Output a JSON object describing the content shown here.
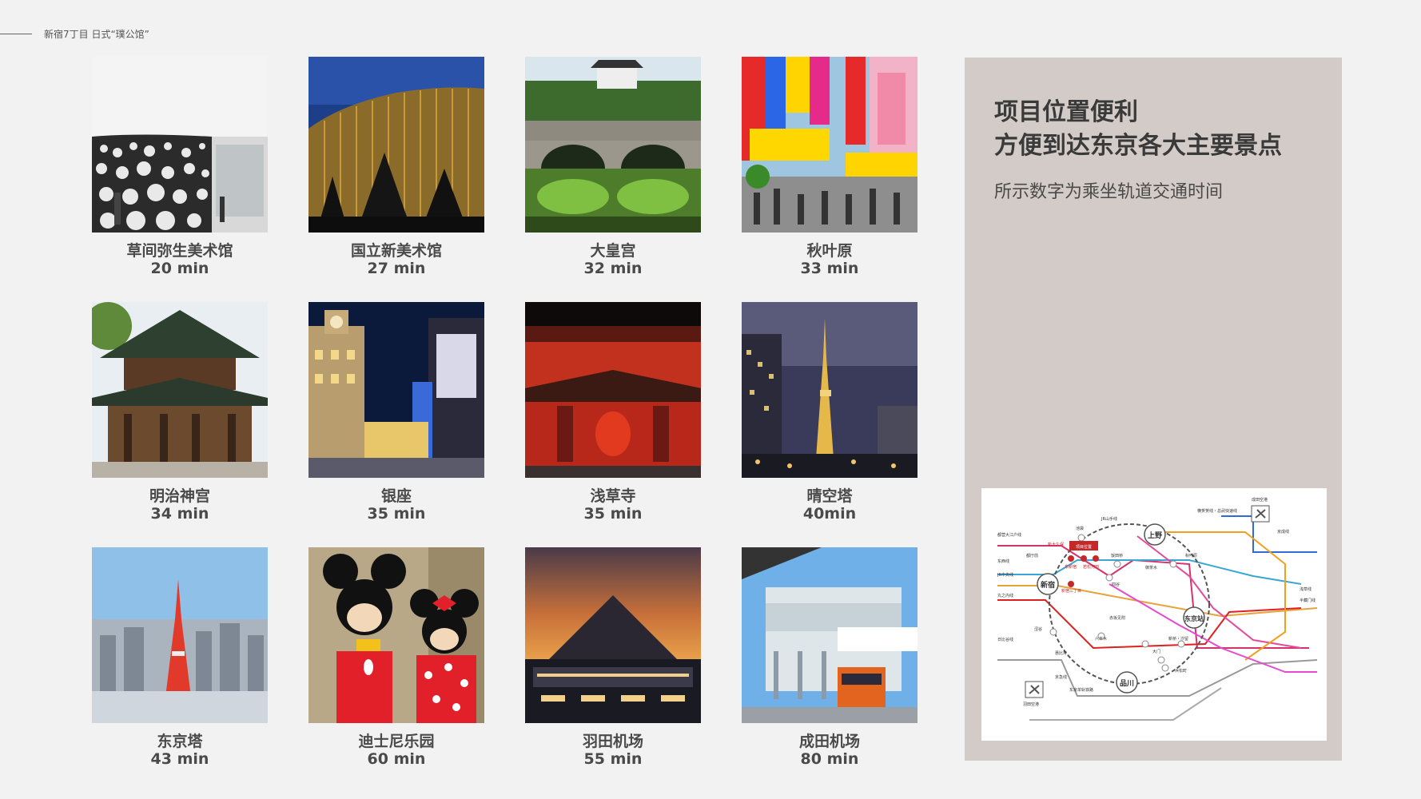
{
  "header": {
    "title": "新宿7丁目 日式“璞公馆”"
  },
  "panel": {
    "title_line1": "项目位置便利",
    "title_line2": "方便到达东京各大主要景点",
    "subtitle": "所示数字为乘坐轨道交通时间"
  },
  "spots": [
    {
      "name": "草间弥生美术馆",
      "time": "20 min"
    },
    {
      "name": "国立新美术馆",
      "time": "27 min"
    },
    {
      "name": "大皇宫",
      "time": "32 min"
    },
    {
      "name": "秋叶原",
      "time": "33 min"
    },
    {
      "name": "明治神宫",
      "time": "34 min"
    },
    {
      "name": "银座",
      "time": "35 min"
    },
    {
      "name": "浅草寺",
      "time": "35 min"
    },
    {
      "name": "晴空塔",
      "time": "40min"
    },
    {
      "name": "东京塔",
      "time": "43 min"
    },
    {
      "name": "迪士尼乐园",
      "time": "60 min"
    },
    {
      "name": "羽田机场",
      "time": "55 min"
    },
    {
      "name": "成田机场",
      "time": "80 min"
    }
  ],
  "map": {
    "stations": {
      "ueno": "上野",
      "shinjuku": "新宿",
      "tokyo": "东京站",
      "shinagawa": "品川",
      "project": "项目位置",
      "narita": "成田空港",
      "haneda": "羽田空港",
      "akihabara": "秋叶原",
      "ikebukuro": "池袋",
      "shibuya": "涩谷",
      "iidabashi": "饭田桥",
      "ochanomizu": "御茶水",
      "yotsuya": "四谷",
      "akasaka": "赤坂见附",
      "roppongi": "六本木",
      "daimon": "大门",
      "shimbashi": "新桥・汐留",
      "hamamatsucho": "浜松町",
      "ebisu": "惠比寿",
      "tochomae": "都厅前",
      "shinokubo": "新大久保",
      "higashishinjuku": "东新宿",
      "wakamatsu": "若松河田",
      "shinjuku3": "新宿三丁目",
      "asakusabashi": "浅草线",
      "ryogoku": "半藏门线"
    },
    "lines": {
      "oedo": "都营大江户线",
      "tozai": "东西线",
      "chuo": "JR中央线",
      "marunouchi": "丸之内线",
      "hibiya": "日比谷线",
      "yamanote": "JR山手线",
      "keisei": "京成线",
      "keisei_skyliner": "横贺贺线・总武快速线",
      "keikyu": "京急线",
      "monorail": "东京单轨铁路"
    },
    "colors": {
      "yamanote": "#555555",
      "oedo": "#d6336c",
      "chuo": "#e8a23a",
      "tozai": "#3aa6d6",
      "marunouchi": "#e02020",
      "hibiya": "#999999",
      "keisei": "#2e6bd8",
      "ginza": "#f2a01e",
      "narita_express": "#c9c9c9",
      "keikyu": "#aaaaaa"
    }
  }
}
